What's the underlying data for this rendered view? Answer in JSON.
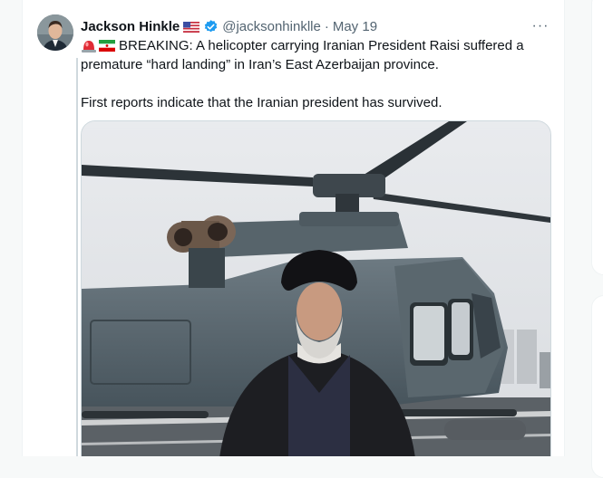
{
  "tweet": {
    "author_name": "Jackson Hinkle",
    "author_flag_icon": "us-flag-icon",
    "handle": "@jacksonhinklle",
    "separator": "·",
    "date": "May 19",
    "more_label": "···",
    "text_line1": "BREAKING: A helicopter carrying Iranian President Raisi suffered a premature “hard landing” in Iran’s East Azerbaijan province.",
    "text_line2": "First reports indicate that the Iranian president has survived.",
    "emoji_icons": [
      "alarm-siren-icon",
      "iran-flag-icon"
    ],
    "media_description_icon": "helicopter-photo"
  },
  "colors": {
    "accent": "#1d9bf0",
    "text": "#0f1419",
    "muted": "#536471",
    "border": "#cfd9de"
  }
}
